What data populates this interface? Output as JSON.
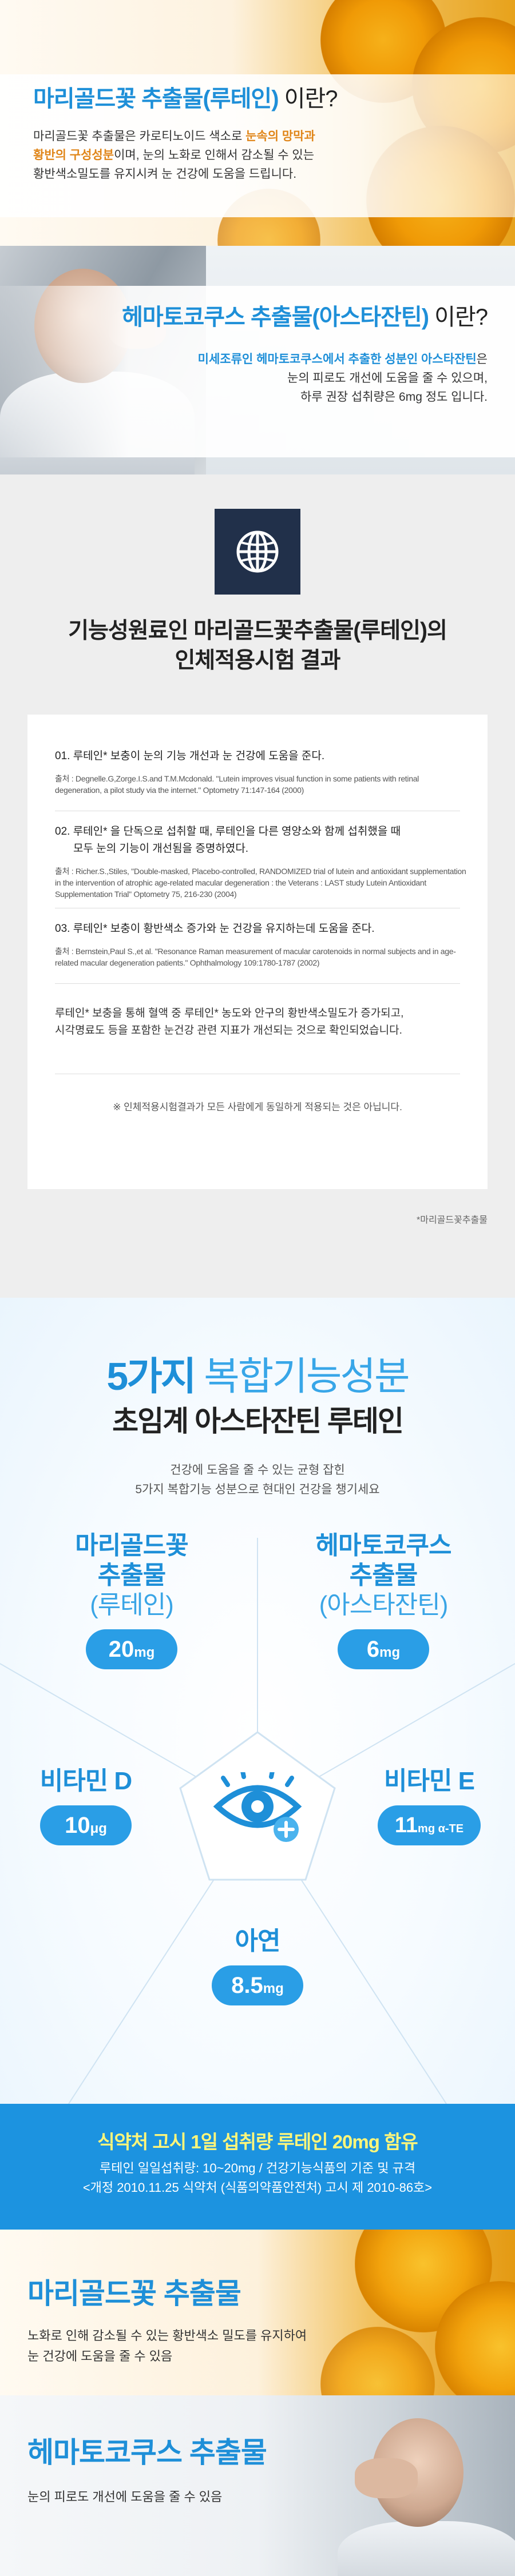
{
  "section_marigold": {
    "title_blue": "마리골드꽃 추출물(루테인)",
    "title_black": " 이란?",
    "desc_part1": "마리골드꽃 추출물은 카로티노이드 색소로 ",
    "desc_hl1": "눈속의 망막과",
    "desc_hl2": "황반의 구성성분",
    "desc_part2": "이며, 눈의 노화로 인해서 감소될 수 있는",
    "desc_line3": "황반색소밀도를 유지시켜 눈 건강에 도움을 드립니다."
  },
  "section_haemato": {
    "title_blue": "헤마토코쿠스 추출물(아스타잔틴)",
    "title_black": " 이란?",
    "desc_blue": "미세조류인 헤마토코쿠스에서 추출한 성분인 아스타잔틴",
    "desc_part1": "은",
    "desc_line2": "눈의 피로도 개선에 도움을 줄 수 있으며,",
    "desc_line3": "하루 권장 섭취량은 6mg 정도 입니다."
  },
  "section_trial": {
    "icon": "globe-icon",
    "heading_line1": "기능성원료인 마리골드꽃추출물(루테인)의",
    "heading_line2": "인체적용시험 결과",
    "items": [
      {
        "heading": "01. 루테인* 보충이 눈의 기능 개선과 눈 건강에 도움을 준다.",
        "source": "출처 : Degnelle.G,Zorge.I.S.and T.M.Mcdonald. \"Lutein improves visual function in some patients with retinal degeneration, a pilot study via the internet.\" Optometry 71:147-164 (2000)"
      },
      {
        "heading_line1": "02. 루테인* 을 단독으로 섭취할 때, 루테인을 다른 영양소와 함께 섭취했을 때",
        "heading_line2": "모두 눈의 기능이 개선됨을 증명하였다.",
        "source": "출처 : Richer.S.,Stiles, \"Double-masked, Placebo-controlled, RANDOMIZED trial of lutein and antioxidant supplementation in the intervention of atrophic age-related macular degeneration : the Veterans : LAST study Lutein Antioxidant Supplementation Trial\" Optometry 75, 216-230 (2004)"
      },
      {
        "heading": "03. 루테인* 보충이 황반색소 증가와 눈 건강을 유지하는데 도움을 준다.",
        "source": "출처 : Bernstein,Paul S.,et al. \"Resonance Raman measurement of macular carotenoids in normal subjects  and in age-related macular degeneration patients.\" Ophthalmology 109:1780-1787 (2002)"
      }
    ],
    "summary_line1": "루테인* 보충을 통해 혈액 중 루테인* 농도와 안구의 황반색소밀도가 증가되고,",
    "summary_line2": "시각명료도 등을 포함한 눈건강 관련 지표가 개선되는 것으로 확인되었습니다.",
    "notice": "※ 인체적용시험결과가 모든 사람에게 동일하게 적용되는 것은 아닙니다.",
    "footnote": "*마리골드꽃추출물"
  },
  "section_five": {
    "big_bold": "5가지",
    "big_light": " 복합기능성분",
    "subtitle": "초임계 아스타잔틴 루테인",
    "lead_line1": "건강에 도움을 줄 수 있는 균형 잡힌",
    "lead_line2": "5가지 복합기능 성분으로 현대인 건강을 챙기세요",
    "center_icon": "eye-plus-icon",
    "ingredients": [
      {
        "name1": "마리골드꽃",
        "name2": "추출물",
        "name3": "(루테인)",
        "amount": "20",
        "unit": "mg"
      },
      {
        "name1": "헤마토코쿠스",
        "name2": "추출물",
        "name3": "(아스타잔틴)",
        "amount": "6",
        "unit": "mg"
      },
      {
        "name1": "비타민 D",
        "amount": "10",
        "unit": "μg"
      },
      {
        "name1": "비타민 E",
        "amount": "11",
        "unit": "mg α-TE"
      },
      {
        "name1": "아연",
        "amount": "8.5",
        "unit": "mg"
      }
    ],
    "colors": {
      "accent": "#1e8fd8",
      "pill": "#2a9ee6"
    }
  },
  "section_banner": {
    "title": "식약처 고시 1일 섭취량 루테인 20mg 함유",
    "line1": "루테인 일일섭취량: 10~20mg / 건강기능식품의 기준 및 규격",
    "line2": "<개정 2010.11.25 식약처 (식품의약품안전처) 고시 제 2010-86호>"
  },
  "section_marigold2": {
    "title": "마리골드꽃 추출물",
    "line1": "노화로 인해 감소될 수 있는 황반색소 밀도를 유지하여",
    "line2": "눈 건강에 도움을 줄 수 있음"
  },
  "section_haemato2": {
    "title": "헤마토코쿠스 추출물",
    "line1": "눈의 피로도 개선에 도움을 줄 수 있음"
  }
}
